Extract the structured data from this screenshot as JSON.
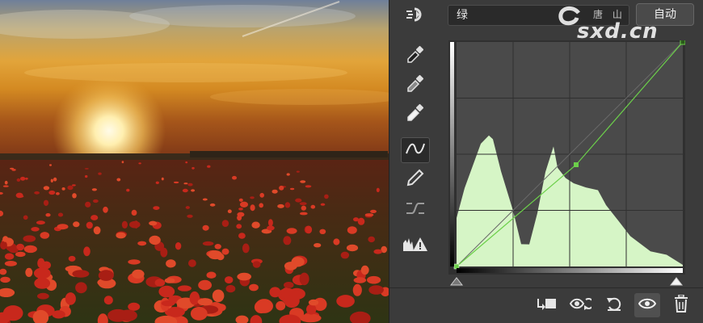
{
  "panel": {
    "channel": "绿",
    "auto_label": "自动",
    "accent": "#6cd04a",
    "histogram_fill": "#d6f5c6"
  },
  "watermark": {
    "text": "sxd.cn",
    "subtext": "唐 山"
  },
  "tools": [
    {
      "name": "targeted-adjust-icon"
    },
    {
      "name": "black-point-eyedropper-icon"
    },
    {
      "name": "gray-point-eyedropper-icon"
    },
    {
      "name": "white-point-eyedropper-icon"
    },
    {
      "name": "curve-point-icon"
    },
    {
      "name": "pencil-icon"
    },
    {
      "name": "smooth-curve-icon"
    },
    {
      "name": "clipping-warning-icon"
    }
  ],
  "bottom_bar": [
    {
      "name": "clip-to-layer-icon"
    },
    {
      "name": "view-previous-state-icon"
    },
    {
      "name": "reset-icon"
    },
    {
      "name": "visibility-eye-icon"
    },
    {
      "name": "delete-icon"
    }
  ]
}
